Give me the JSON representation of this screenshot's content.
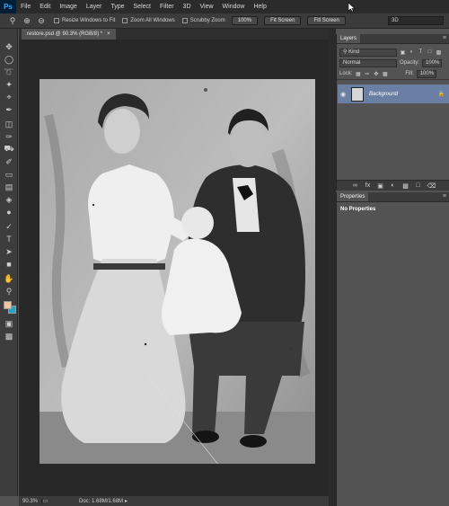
{
  "app": {
    "logo": "Ps"
  },
  "menu": [
    "File",
    "Edit",
    "Image",
    "Layer",
    "Type",
    "Select",
    "Filter",
    "3D",
    "View",
    "Window",
    "Help"
  ],
  "options_bar": {
    "resize_windows": "Resize Windows to Fit",
    "zoom_all": "Zoom All Windows",
    "scrubby_zoom": "Scrubby Zoom",
    "btn_100": "100%",
    "btn_fit": "Fit Screen",
    "btn_fill": "Fill Screen",
    "workspace": "3D"
  },
  "document": {
    "tab_title": "restore.psd @ 90.3% (RGB/8) *",
    "close": "×"
  },
  "status": {
    "zoom": "90.3%",
    "doc_size": "Doc: 1.68M/1.68M"
  },
  "layers_panel": {
    "tab": "Layers",
    "kind_label": "Kind",
    "blend_mode": "Normal",
    "opacity_label": "Opacity:",
    "opacity_value": "100%",
    "lock_label": "Lock:",
    "fill_label": "Fill:",
    "fill_value": "100%",
    "layer_name": "Background"
  },
  "properties_panel": {
    "tab": "Properties",
    "message": "No Properties"
  },
  "colors": {
    "foreground": "#f4c49c",
    "background": "#21a5c9"
  },
  "tools": [
    "move-icon",
    "marquee-icon",
    "lasso-icon",
    "quick-select-icon",
    "crop-icon",
    "eyedropper-icon",
    "healing-brush-icon",
    "brush-icon",
    "clone-stamp-icon",
    "history-brush-icon",
    "eraser-icon",
    "gradient-icon",
    "blur-icon",
    "dodge-icon",
    "pen-icon",
    "type-icon",
    "path-select-icon",
    "rectangle-icon",
    "hand-icon",
    "zoom-icon"
  ]
}
